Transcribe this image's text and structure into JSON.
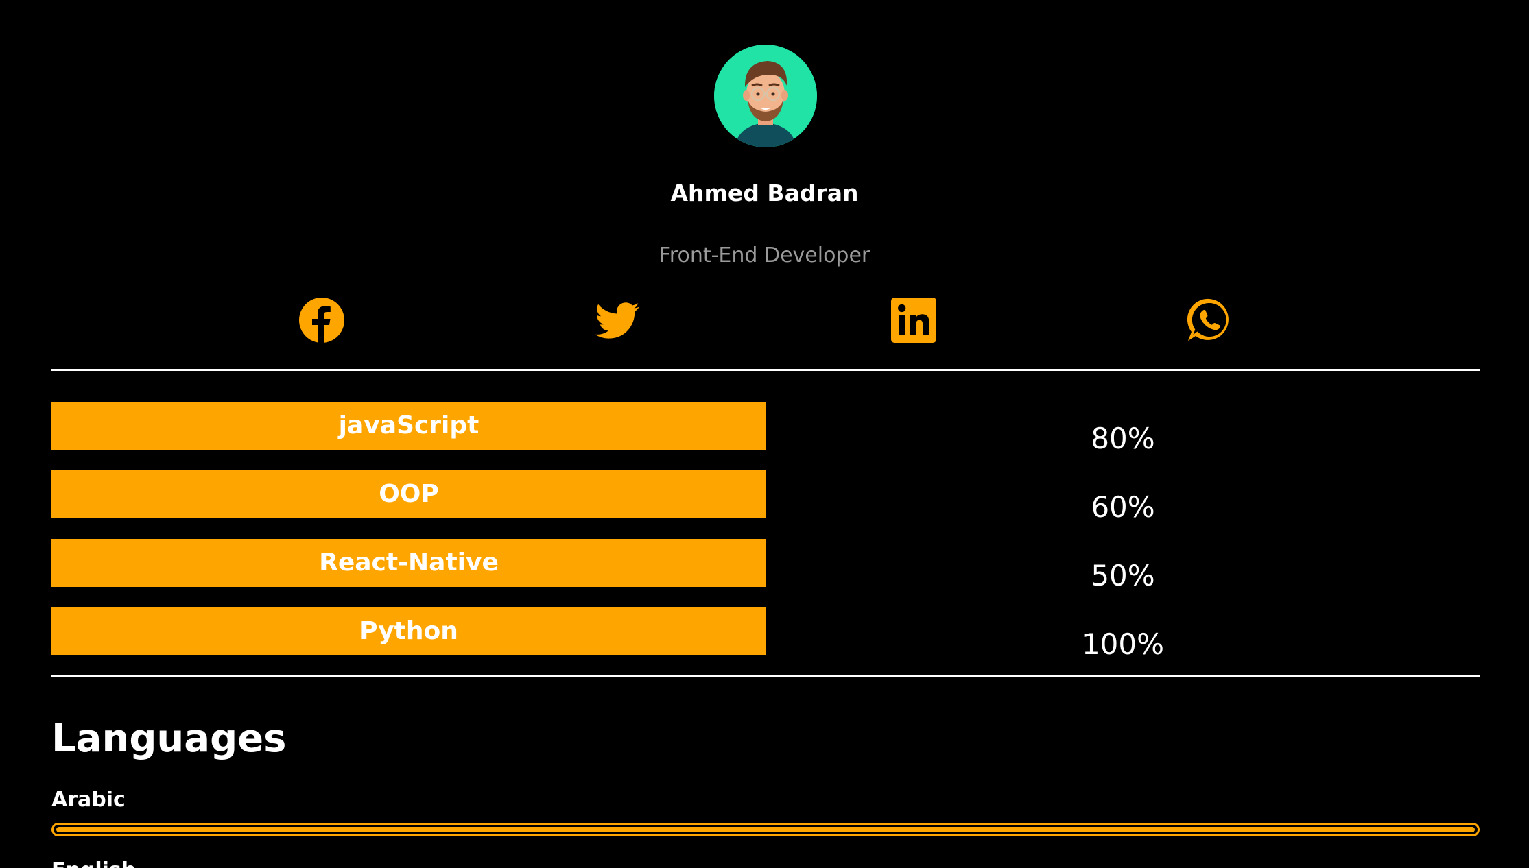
{
  "profile": {
    "name": "Ahmed Badran",
    "role": "Front-End Developer"
  },
  "social": [
    {
      "icon": "facebook-icon"
    },
    {
      "icon": "twitter-icon"
    },
    {
      "icon": "linkedin-icon"
    },
    {
      "icon": "whatsapp-icon"
    }
  ],
  "skills": [
    {
      "label": "javaScript",
      "percent": "80%"
    },
    {
      "label": "OOP",
      "percent": "60%"
    },
    {
      "label": "React-Native",
      "percent": "50%"
    },
    {
      "label": "Python",
      "percent": "100%"
    }
  ],
  "languages": {
    "title": "Languages",
    "items": [
      {
        "label": "Arabic",
        "level": 1.0
      },
      {
        "label": "English",
        "level": null
      }
    ]
  },
  "colors": {
    "accent": "#ffa500",
    "background": "#000000",
    "avatar_bg": "#22e3a6"
  }
}
